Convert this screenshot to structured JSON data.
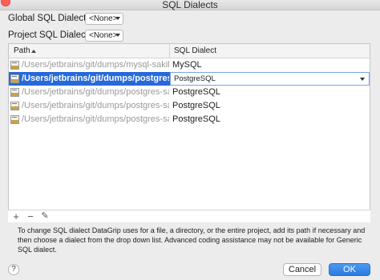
{
  "window": {
    "title": "SQL Dialects"
  },
  "global": {
    "label": "Global SQL Dialect:",
    "value": "<None>"
  },
  "project": {
    "label": "Project SQL Dialect:",
    "value": "<None>"
  },
  "table": {
    "columns": [
      "Path",
      "SQL Dialect"
    ],
    "rows": [
      {
        "path": "/Users/jetbrains/git/dumps/mysql-sakila-db",
        "dialect": "MySQL",
        "selected": false
      },
      {
        "path": "/Users/jetbrains/git/dumps/postgres-sakila-db",
        "dialect": "PostgreSQL",
        "selected": true
      },
      {
        "path": "/Users/jetbrains/git/dumps/postgres-sakila-db",
        "dialect": "PostgreSQL",
        "selected": false
      },
      {
        "path": "/Users/jetbrains/git/dumps/postgres-sakila-db",
        "dialect": "PostgreSQL",
        "selected": false
      },
      {
        "path": "/Users/jetbrains/git/dumps/postgres-sakila-db",
        "dialect": "PostgreSQL",
        "selected": false
      }
    ]
  },
  "toolbar": {
    "add": "+",
    "remove": "−",
    "edit": "✎"
  },
  "hint": "To change SQL dialect DataGrip uses for a file, a directory, or the entire project, add its path if necessary and then choose a dialect from the drop down list. Advanced coding assistance may not be available for Generic SQL dialect.",
  "buttons": {
    "help": "?",
    "cancel": "Cancel",
    "ok": "OK"
  }
}
